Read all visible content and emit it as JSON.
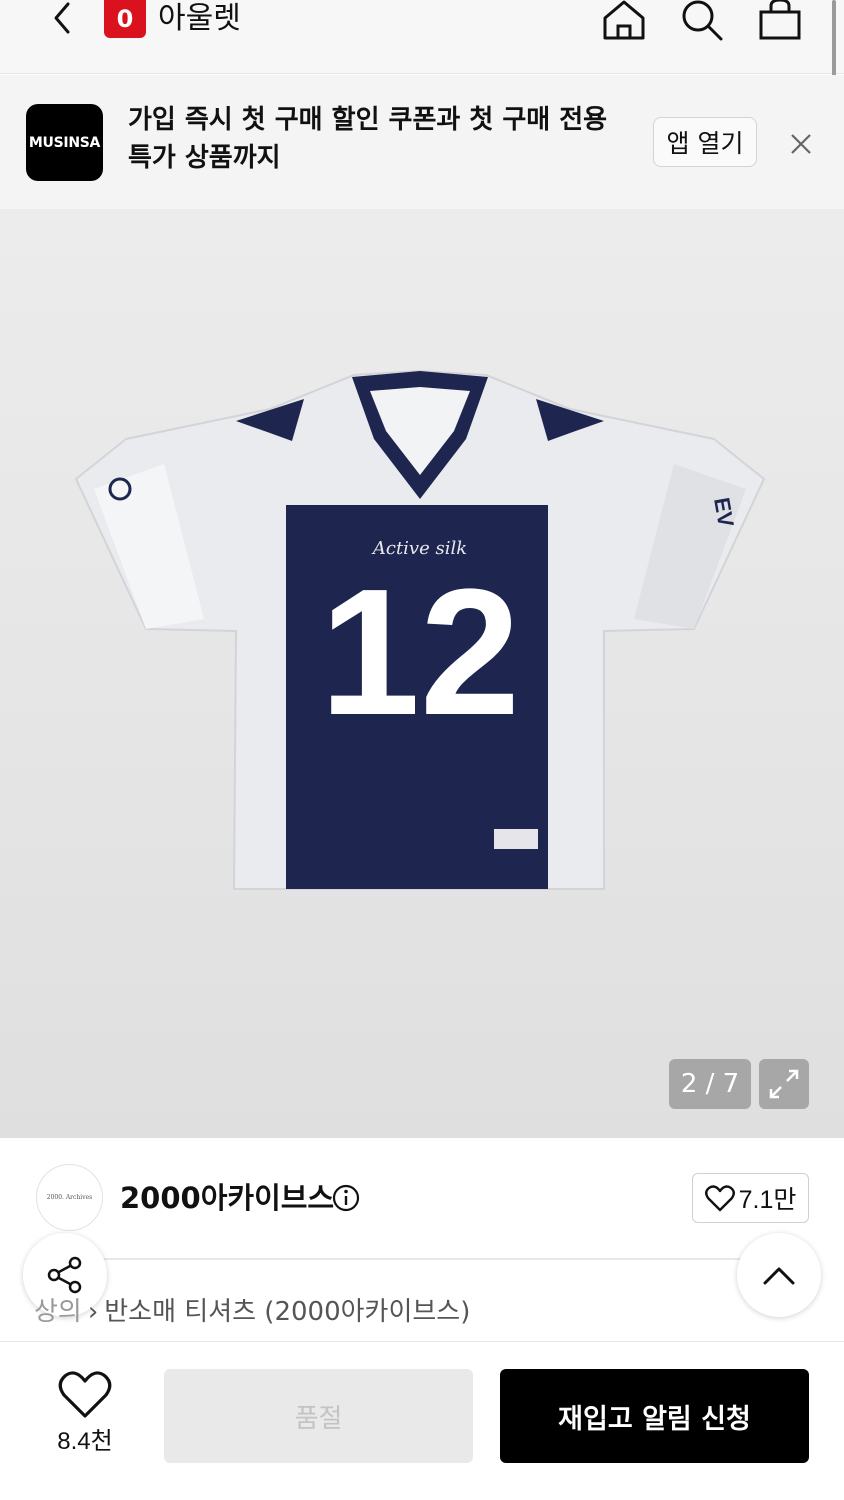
{
  "nav": {
    "outlet_badge": "0",
    "title": "아울렛",
    "icons": [
      "back-chevron-icon",
      "home-icon",
      "search-icon",
      "bag-icon"
    ]
  },
  "banner": {
    "logo_text": "MUSINSA",
    "message": "가입 즉시 첫 구매 할인 쿠폰과 첫 구매 전용 특가 상품까지",
    "open_app_label": "앱 열기",
    "close_icon": "close-icon"
  },
  "gallery": {
    "counter": "2 / 7",
    "expand_icon": "expand-icon",
    "jersey_number": "12"
  },
  "brand": {
    "logo_text": "2000. Archives",
    "name": "2000아카이브스",
    "info_icon": "info-icon",
    "likes": "7.1만"
  },
  "breadcrumb": {
    "category": "상의",
    "subcategory": "반소매 티셔츠 (2000아카이브스)"
  },
  "bottom": {
    "like_count": "8.4천",
    "soldout_label": "품절",
    "restock_label": "재입고 알림 신청"
  },
  "colors": {
    "outlet_red": "#d9121d",
    "navy": "#1e2650",
    "black": "#000000"
  }
}
